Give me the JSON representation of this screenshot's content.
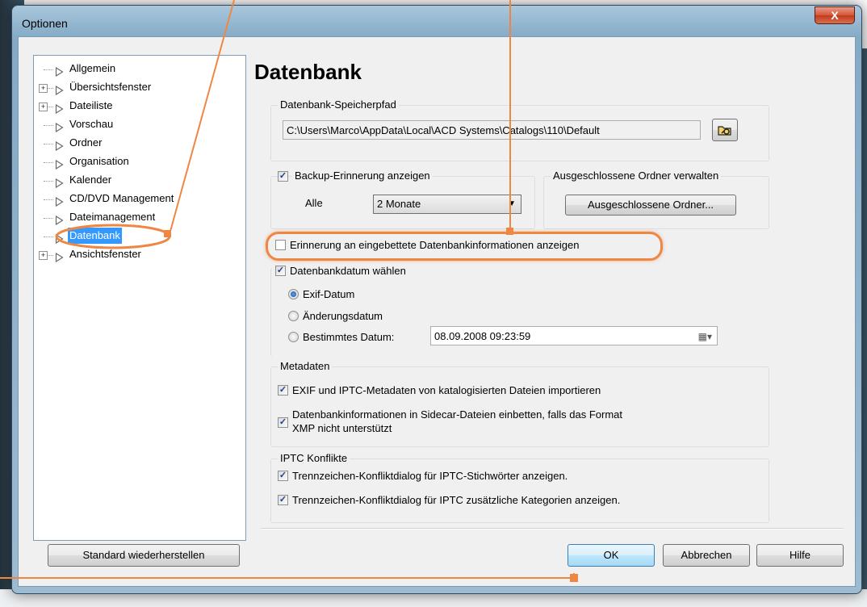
{
  "window": {
    "title": "Optionen",
    "close_label": "X"
  },
  "tree": {
    "items": [
      {
        "label": "Allgemein",
        "expander": ""
      },
      {
        "label": "Übersichtsfenster",
        "expander": "+"
      },
      {
        "label": "Dateiliste",
        "expander": "+"
      },
      {
        "label": "Vorschau",
        "expander": ""
      },
      {
        "label": "Ordner",
        "expander": ""
      },
      {
        "label": "Organisation",
        "expander": ""
      },
      {
        "label": "Kalender",
        "expander": ""
      },
      {
        "label": "CD/DVD Management",
        "expander": ""
      },
      {
        "label": "Dateimanagement",
        "expander": ""
      },
      {
        "label": "Datenbank",
        "expander": "",
        "selected": true
      },
      {
        "label": "Ansichtsfenster",
        "expander": "+"
      }
    ]
  },
  "page": {
    "heading": "Datenbank"
  },
  "db_path": {
    "group_title": "Datenbank-Speicherpfad",
    "value": "C:\\Users\\Marco\\AppData\\Local\\ACD Systems\\Catalogs\\110\\Default",
    "browse_icon": "browse-folder-icon"
  },
  "backup": {
    "label": "Backup-Erinnerung anzeigen",
    "checked": true,
    "interval_label": "Alle",
    "interval_value": "2 Monate"
  },
  "excluded": {
    "group_title": "Ausgeschlossene Ordner verwalten",
    "button_label": "Ausgeschlossene Ordner..."
  },
  "embedded_reminder": {
    "label": "Erinnerung an eingebettete Datenbankinformationen anzeigen",
    "checked": false
  },
  "db_date": {
    "label": "Datenbankdatum wählen",
    "checked": true,
    "options": [
      "Exif-Datum",
      "Änderungsdatum",
      "Bestimmtes Datum:"
    ],
    "selected": "Exif-Datum",
    "specific_value": "08.09.2008 09:23:59"
  },
  "metadata": {
    "group_title": "Metadaten",
    "import_label": "EXIF und IPTC-Metadaten von katalogisierten Dateien importieren",
    "embed_label_line1": "Datenbankinformationen in Sidecar-Dateien einbetten, falls das Format",
    "embed_label_line2": "XMP nicht unterstützt"
  },
  "iptc": {
    "group_title": "IPTC Konflikte",
    "keywords_label": "Trennzeichen-Konfliktdialog für IPTC-Stichwörter anzeigen.",
    "categories_label": "Trennzeichen-Konfliktdialog für IPTC zusätzliche Kategorien anzeigen."
  },
  "buttons": {
    "restore": "Standard wiederherstellen",
    "ok": "OK",
    "cancel": "Abbrechen",
    "help": "Hilfe"
  },
  "colors": {
    "annotation": "#ee8744",
    "selection": "#3399ff"
  }
}
